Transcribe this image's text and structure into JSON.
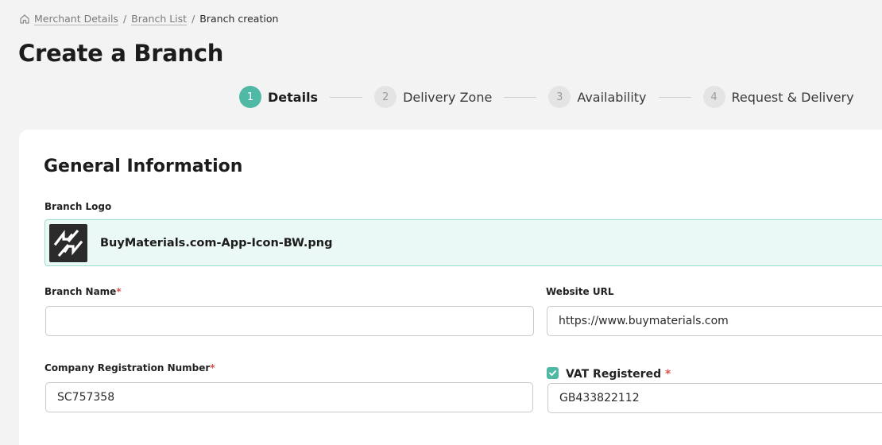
{
  "breadcrumb": {
    "items": [
      "Merchant Details",
      "Branch List"
    ],
    "separator": "/",
    "current": "Branch creation"
  },
  "page": {
    "title": "Create a Branch"
  },
  "stepper": {
    "steps": [
      {
        "number": "1",
        "label": "Details",
        "active": true
      },
      {
        "number": "2",
        "label": "Delivery Zone",
        "active": false
      },
      {
        "number": "3",
        "label": "Availability",
        "active": false
      },
      {
        "number": "4",
        "label": "Request & Delivery",
        "active": false
      }
    ]
  },
  "form": {
    "section_title": "General Information",
    "branch_logo": {
      "label": "Branch Logo",
      "filename": "BuyMaterials.com-App-Icon-BW.png"
    },
    "branch_name": {
      "label": "Branch Name",
      "required_mark": "*",
      "value": ""
    },
    "website_url": {
      "label": "Website URL",
      "value": "https://www.buymaterials.com"
    },
    "company_registration": {
      "label": "Company Registration Number",
      "required_mark": "*",
      "value": "SC757358"
    },
    "vat": {
      "label": "VAT Registered",
      "required_mark": "*",
      "checked": true,
      "value": "GB433822112"
    }
  },
  "colors": {
    "accent": "#4fb9a5",
    "logo_bg": "#ebf9f6",
    "logo_border": "#9fdccf",
    "required": "#d9534f"
  }
}
